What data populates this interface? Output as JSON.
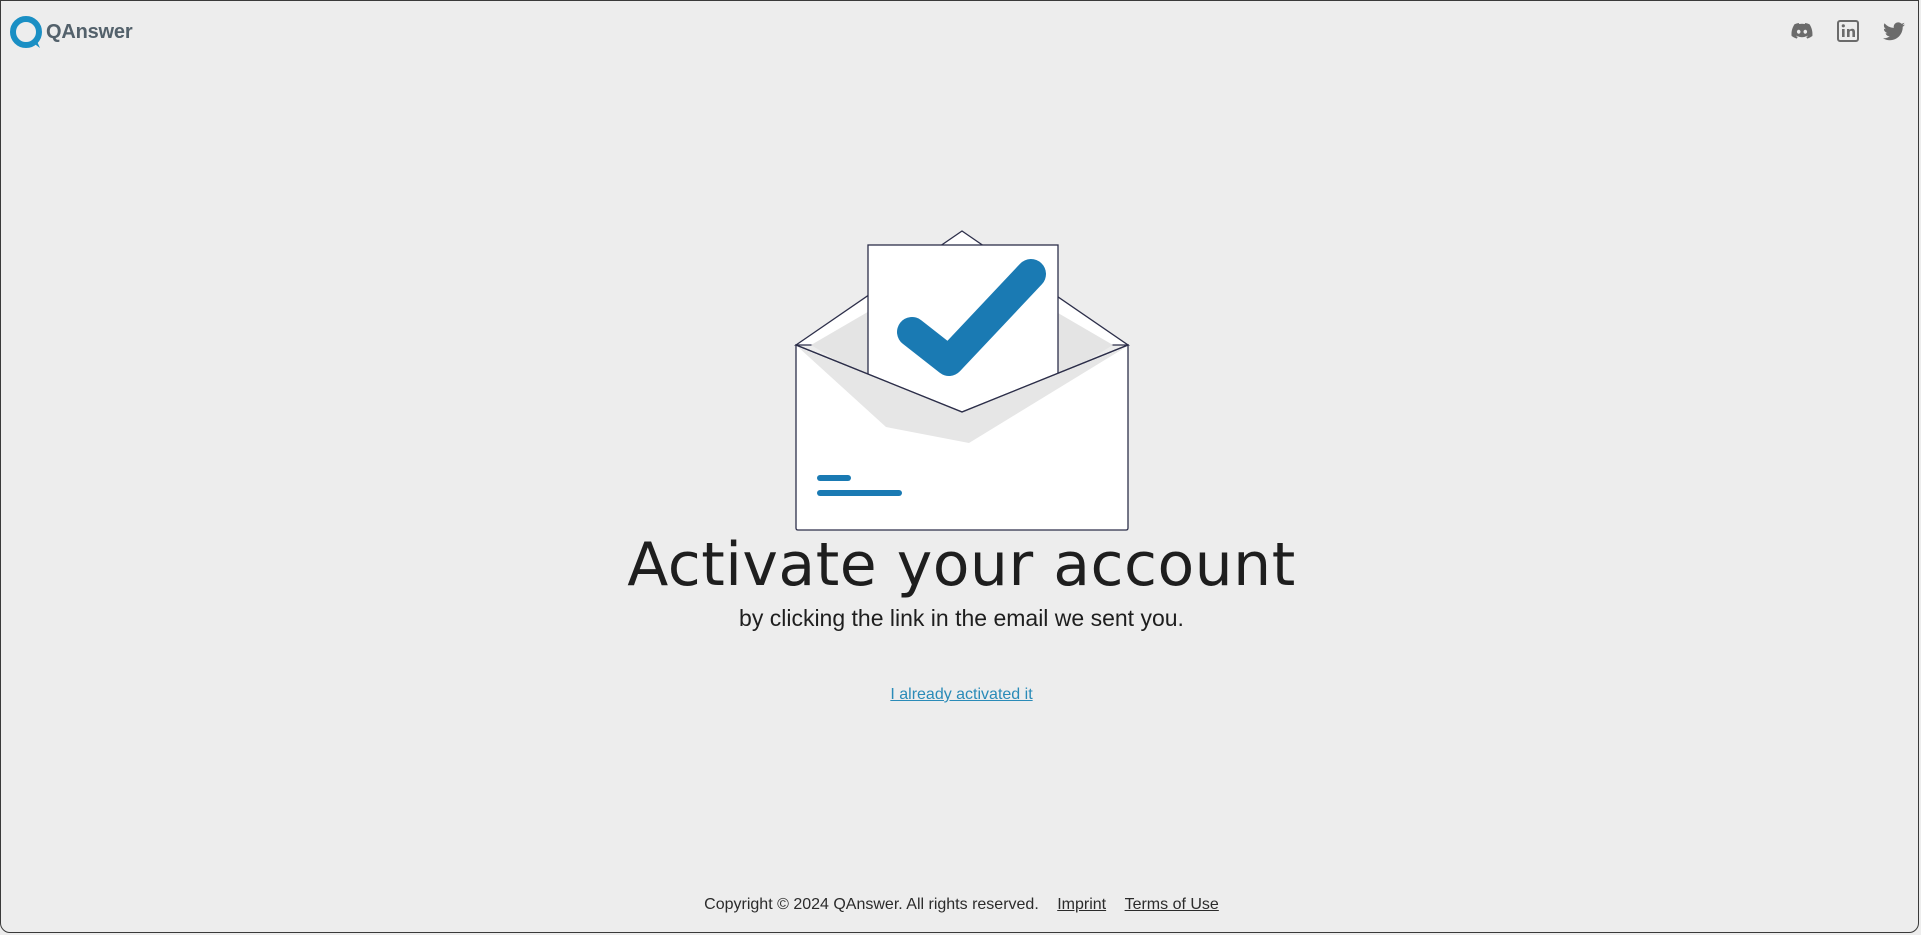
{
  "header": {
    "logo_text": "QAnswer",
    "logo_icon": "qanswer-logo-icon",
    "social": [
      {
        "name": "discord-icon",
        "color": "#6b6b6b"
      },
      {
        "name": "linkedin-icon",
        "color": "#6b6b6b"
      },
      {
        "name": "twitter-icon",
        "color": "#6b6b6b"
      }
    ]
  },
  "main": {
    "illustration_icon": "envelope-checkmark-icon",
    "title": "Activate your account",
    "subtitle": "by clicking the link in the email we sent you.",
    "activated_link": "I already activated it"
  },
  "footer": {
    "copyright": "Copyright © 2024 QAnswer. All rights reserved.",
    "imprint": "Imprint",
    "terms": "Terms of Use"
  },
  "colors": {
    "accent": "#1a7ab3",
    "link": "#2a8bb8",
    "background": "#ededed",
    "logo_text": "#53616b"
  }
}
